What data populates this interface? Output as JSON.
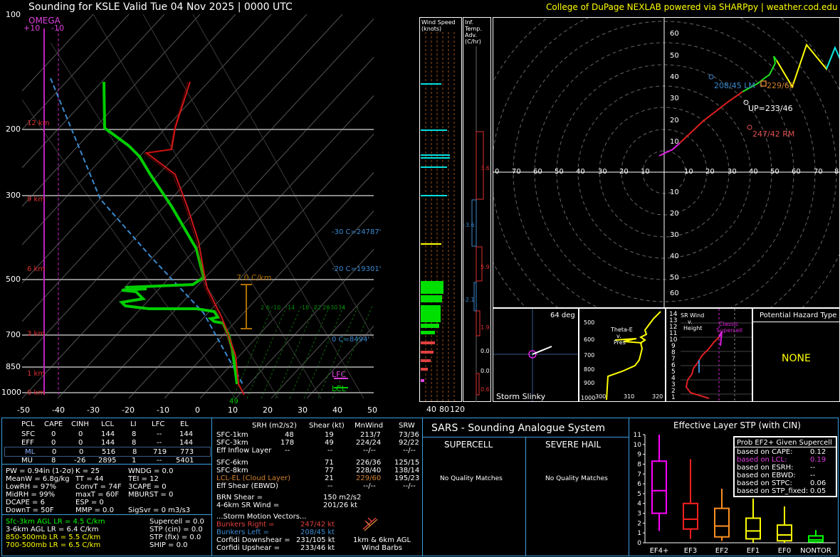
{
  "header": {
    "title": "Sounding for KSLE Valid  Tue 04 Nov 2025 | 0000 UTC",
    "credit": "College of DuPage NEXLAB powered via SHARPpy | weather.cod.edu"
  },
  "skewt": {
    "pressure_labels": [
      "100",
      "200",
      "300",
      "500",
      "700",
      "850",
      "1000"
    ],
    "temp_labels": [
      "-50",
      "-40",
      "-30",
      "-20",
      "-10",
      "0",
      "10",
      "20",
      "30",
      "40",
      "50"
    ],
    "omega_title": "OMEGA",
    "omega_left": "+10",
    "omega_right": "-10",
    "height_labels": [
      "12 km",
      "9 km",
      "6 km",
      "3 km",
      "1 km",
      "0 km"
    ],
    "lapse_label": "7.0 C/km",
    "levels": [
      "-30 C=24787'",
      "-20 C=19301'",
      "0 C=8494'"
    ],
    "lfc": "LFC",
    "lcl": "LCL",
    "sfc_value": "49",
    "mixratio_labels": [
      "2",
      "6",
      "10",
      "14",
      "18",
      "22",
      "26",
      "30",
      "34"
    ]
  },
  "wind_speed": {
    "title": "Wind Speed (knots)",
    "axis": [
      "40",
      "80",
      "120"
    ]
  },
  "inf_temp": {
    "title": "Inf. Temp. Adv. (C/hr)",
    "values": [
      "3.6",
      "-3.6",
      "5.9",
      "-2.1",
      "1.9",
      "0.0",
      "0.0",
      "0.6"
    ]
  },
  "hodograph": {
    "rings": [
      "60",
      "50",
      "40",
      "30",
      "20",
      "10",
      "0",
      "10",
      "20",
      "30",
      "40",
      "50",
      "60"
    ],
    "xlabels": [
      "0",
      "70",
      "60",
      "50",
      "40",
      "30",
      "20",
      "10",
      "10",
      "20",
      "30",
      "40",
      "50",
      "60",
      "70",
      "8"
    ],
    "lm": "208/45 LM",
    "mean": "229/60",
    "up": "UP=233/46",
    "rm": "247/42 RM"
  },
  "storm_slinky": {
    "title": "Storm Slinky",
    "deg": "64 deg"
  },
  "theta_e": {
    "label1": "Theta-E",
    "label2": "v.",
    "label3": "Pres",
    "ylabels": [
      "500",
      "600",
      "700",
      "800",
      "900",
      "1000"
    ],
    "xlabels": [
      "300",
      "310",
      "320"
    ]
  },
  "sr_wind": {
    "title1": "SR Wind",
    "title2": "v.",
    "title3": "Height",
    "classic1": "Classic",
    "classic2": "Supercell",
    "ylabels": [
      "14",
      "13",
      "12",
      "11",
      "10",
      "9",
      "8",
      "7",
      "6",
      "5",
      "4",
      "3",
      "2",
      "1"
    ]
  },
  "hazard": {
    "title": "Potential Hazard Type",
    "value": "NONE"
  },
  "parcels": {
    "headers": [
      "PCL",
      "CAPE",
      "CINH",
      "LCL",
      "LI",
      "LFC",
      "EL"
    ],
    "rows": [
      [
        "SFC",
        "0",
        "0",
        "144",
        "8",
        "--",
        "144"
      ],
      [
        "EFF",
        "0",
        "0",
        "144",
        "8",
        "--",
        "144"
      ],
      [
        "ML",
        "0",
        "0",
        "516",
        "8",
        "719",
        "773"
      ],
      [
        "MU",
        "8",
        "-26",
        "2895",
        "1",
        "--",
        "5401"
      ]
    ]
  },
  "indices": {
    "col1": [
      "PW = 0.94in (1-2σ)",
      "MeanW = 6.8g/kg",
      "LowRH = 97%",
      "MidRH = 99%",
      "DCAPE = 6",
      "DownT = 50F"
    ],
    "col2": [
      "K = 25",
      "TT = 44",
      "ConvT = 74F",
      "maxT = 60F",
      "ESP = 0",
      "MMP = 0.0"
    ],
    "col3": [
      "WNDG = 0.0",
      "TEI = 12",
      "3CAPE = 0",
      "MBURST = 0",
      "",
      ""
    ],
    "sigsvr": "SigSvr = 0 m3/s3"
  },
  "lapse": {
    "rows": [
      "Sfc-3km AGL LR = 4.5 C/km",
      "3-6km AGL LR = 6.4 C/km",
      "850-500mb LR = 5.5 C/km",
      "700-500mb LR = 6.5 C/km"
    ],
    "right": [
      "Supercell = 0.0",
      "STP (cin) = 0.0",
      "STP (fix) = 0.0",
      "SHIP = 0.0"
    ]
  },
  "kinematics": {
    "headers": [
      "SRH (m2/s2)",
      "Shear (kt)",
      "MnWind",
      "SRW"
    ],
    "rows": [
      [
        "SFC-1km",
        "48",
        "19",
        "213/7",
        "73/36"
      ],
      [
        "SFC-3km",
        "178",
        "49",
        "224/24",
        "92/22"
      ],
      [
        "Eff Inflow Layer",
        "--",
        "--",
        "--/--",
        "--/--"
      ],
      [
        "",
        "",
        " ",
        "",
        ""
      ],
      [
        "SFC-6km",
        "71",
        "226/36",
        "125/15"
      ],
      [
        "SFC-8km",
        "77",
        "228/40",
        "138/14"
      ],
      [
        "LCL-EL (Cloud Layer)",
        "21",
        "229/60",
        "195/23"
      ],
      [
        "Eff Shear (EBWD)",
        "--",
        "--/--",
        "--/--"
      ]
    ],
    "brn_shear": [
      "BRN Shear =",
      "150 m2/s2"
    ],
    "sr_wind46": [
      "4-6km SR Wind =",
      "201/26 kt"
    ],
    "storm_motion": "...Storm Motion Vectors...",
    "bunkers_right": [
      "Bunkers Right =",
      "247/42 kt"
    ],
    "bunkers_left": [
      "Bunkers Left =",
      "208/45 kt"
    ],
    "corfidi_down": [
      "Corfidi Downshear =",
      "231/105 kt"
    ],
    "corfidi_up": [
      "Corfidi Upshear =",
      "233/46 kt"
    ],
    "barb_caption1": "1km & 6km AGL",
    "barb_caption2": "Wind Barbs"
  },
  "sars": {
    "title": "SARS - Sounding Analogue System",
    "supercell": "SUPERCELL",
    "hail": "SEVERE HAIL",
    "supercell_result": "No Quality Matches",
    "hail_result": "No Quality Matches"
  },
  "stp": {
    "title": "Effective Layer STP (with CIN)",
    "yticks": [
      "0",
      "1",
      "2",
      "3",
      "4",
      "5",
      "6",
      "7",
      "8",
      "9",
      "10",
      "11"
    ],
    "categories": [
      "EF4+",
      "EF3",
      "EF2",
      "EF1",
      "EF0",
      "NONTOR"
    ],
    "prob_title": "Prob EF2+ Given Supercell",
    "prob_rows": [
      [
        "based on CAPE:",
        "0.12"
      ],
      [
        "based on LCL:",
        "0.19"
      ],
      [
        "based on ESRH:",
        "--"
      ],
      [
        "based on EBWD:",
        "--"
      ],
      [
        "based on STPC:",
        "0.06"
      ],
      [
        "based on STP_fixed:",
        "0.05"
      ]
    ]
  },
  "chart_data": {
    "type": "box",
    "title": "Effective Layer STP (with CIN)",
    "categories": [
      "EF4+",
      "EF3",
      "EF2",
      "EF1",
      "EF0",
      "NONTOR"
    ],
    "ylim": [
      0,
      11
    ],
    "boxes": [
      {
        "name": "EF4+",
        "min": 1.2,
        "q1": 3.0,
        "median": 5.3,
        "q3": 8.3,
        "max": 11.0,
        "color": "#ff00ff"
      },
      {
        "name": "EF3",
        "min": 0.4,
        "q1": 1.4,
        "median": 2.4,
        "q3": 4.0,
        "max": 8.5,
        "color": "#ff2020"
      },
      {
        "name": "EF2",
        "min": 0.2,
        "q1": 0.6,
        "median": 1.7,
        "q3": 3.5,
        "max": 5.5,
        "color": "#ff9020"
      },
      {
        "name": "EF1",
        "min": 0.0,
        "q1": 0.4,
        "median": 1.2,
        "q3": 2.5,
        "max": 4.5,
        "color": "#ffff00"
      },
      {
        "name": "EF0",
        "min": 0.0,
        "q1": 0.2,
        "median": 0.8,
        "q3": 1.8,
        "max": 3.7,
        "color": "#ffff00"
      },
      {
        "name": "NONTOR",
        "min": 0.0,
        "q1": 0.1,
        "median": 0.3,
        "q3": 0.7,
        "max": 1.3,
        "color": "#00ff00"
      }
    ]
  }
}
